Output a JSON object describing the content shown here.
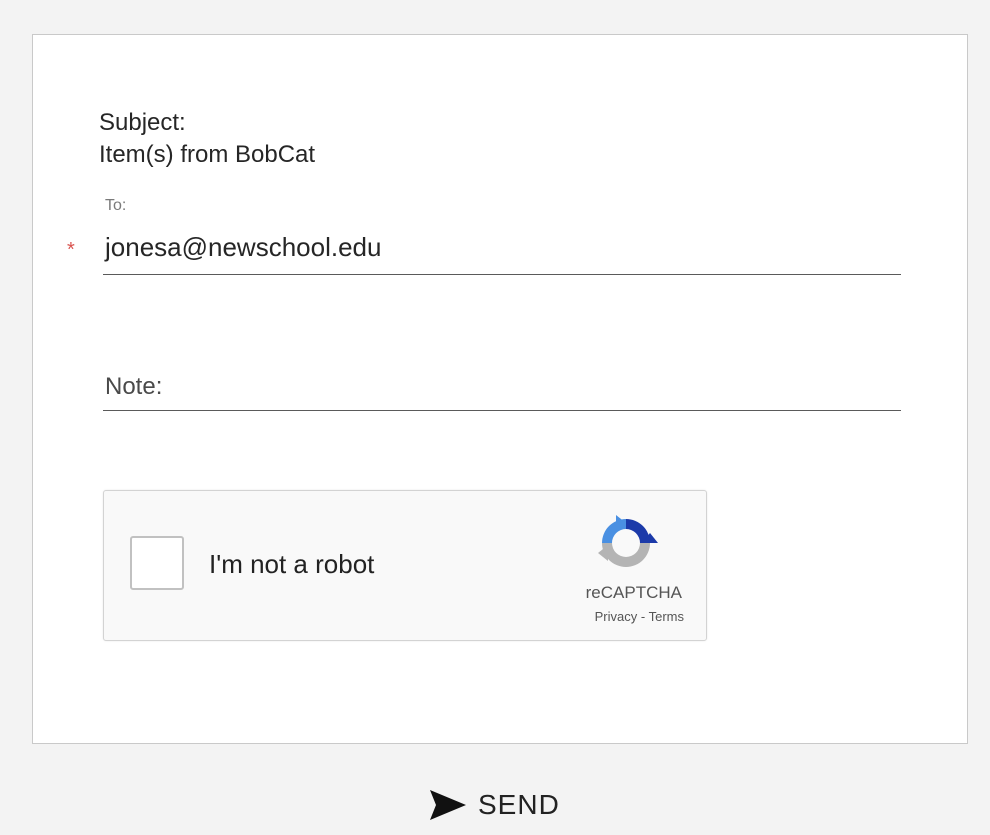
{
  "form": {
    "subject_label": "Subject:",
    "subject_value": "Item(s) from BobCat",
    "to_label": "To:",
    "required_marker": "*",
    "to_value": "jonesa@newschool.edu",
    "note_placeholder": "Note:"
  },
  "recaptcha": {
    "checkbox_label": "I'm not a robot",
    "brand": "reCAPTCHA",
    "privacy_link": "Privacy",
    "separator": "-",
    "terms_link": "Terms"
  },
  "actions": {
    "send_label": "SEND"
  },
  "colors": {
    "required_star": "#d9534f",
    "recaptcha_blue": "#1c3aa9",
    "recaptcha_light_blue": "#4a90e2",
    "recaptcha_gray": "#b4b4b4"
  },
  "icons": {
    "send": "send-icon",
    "recaptcha": "recaptcha-logo-icon"
  }
}
